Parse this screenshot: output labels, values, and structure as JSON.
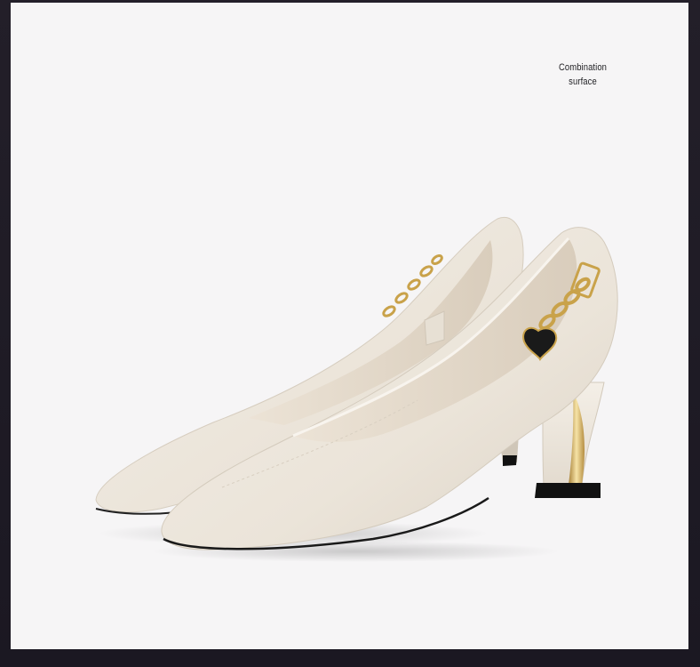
{
  "caption": {
    "line1": "Combination",
    "line2": "surface"
  },
  "colors": {
    "background": "#f6f5f6",
    "frame": "#1d1a24",
    "leather": "#ece6dc",
    "lining": "#e2d7c9",
    "gold": "#c9a24a",
    "sole": "#111111"
  }
}
